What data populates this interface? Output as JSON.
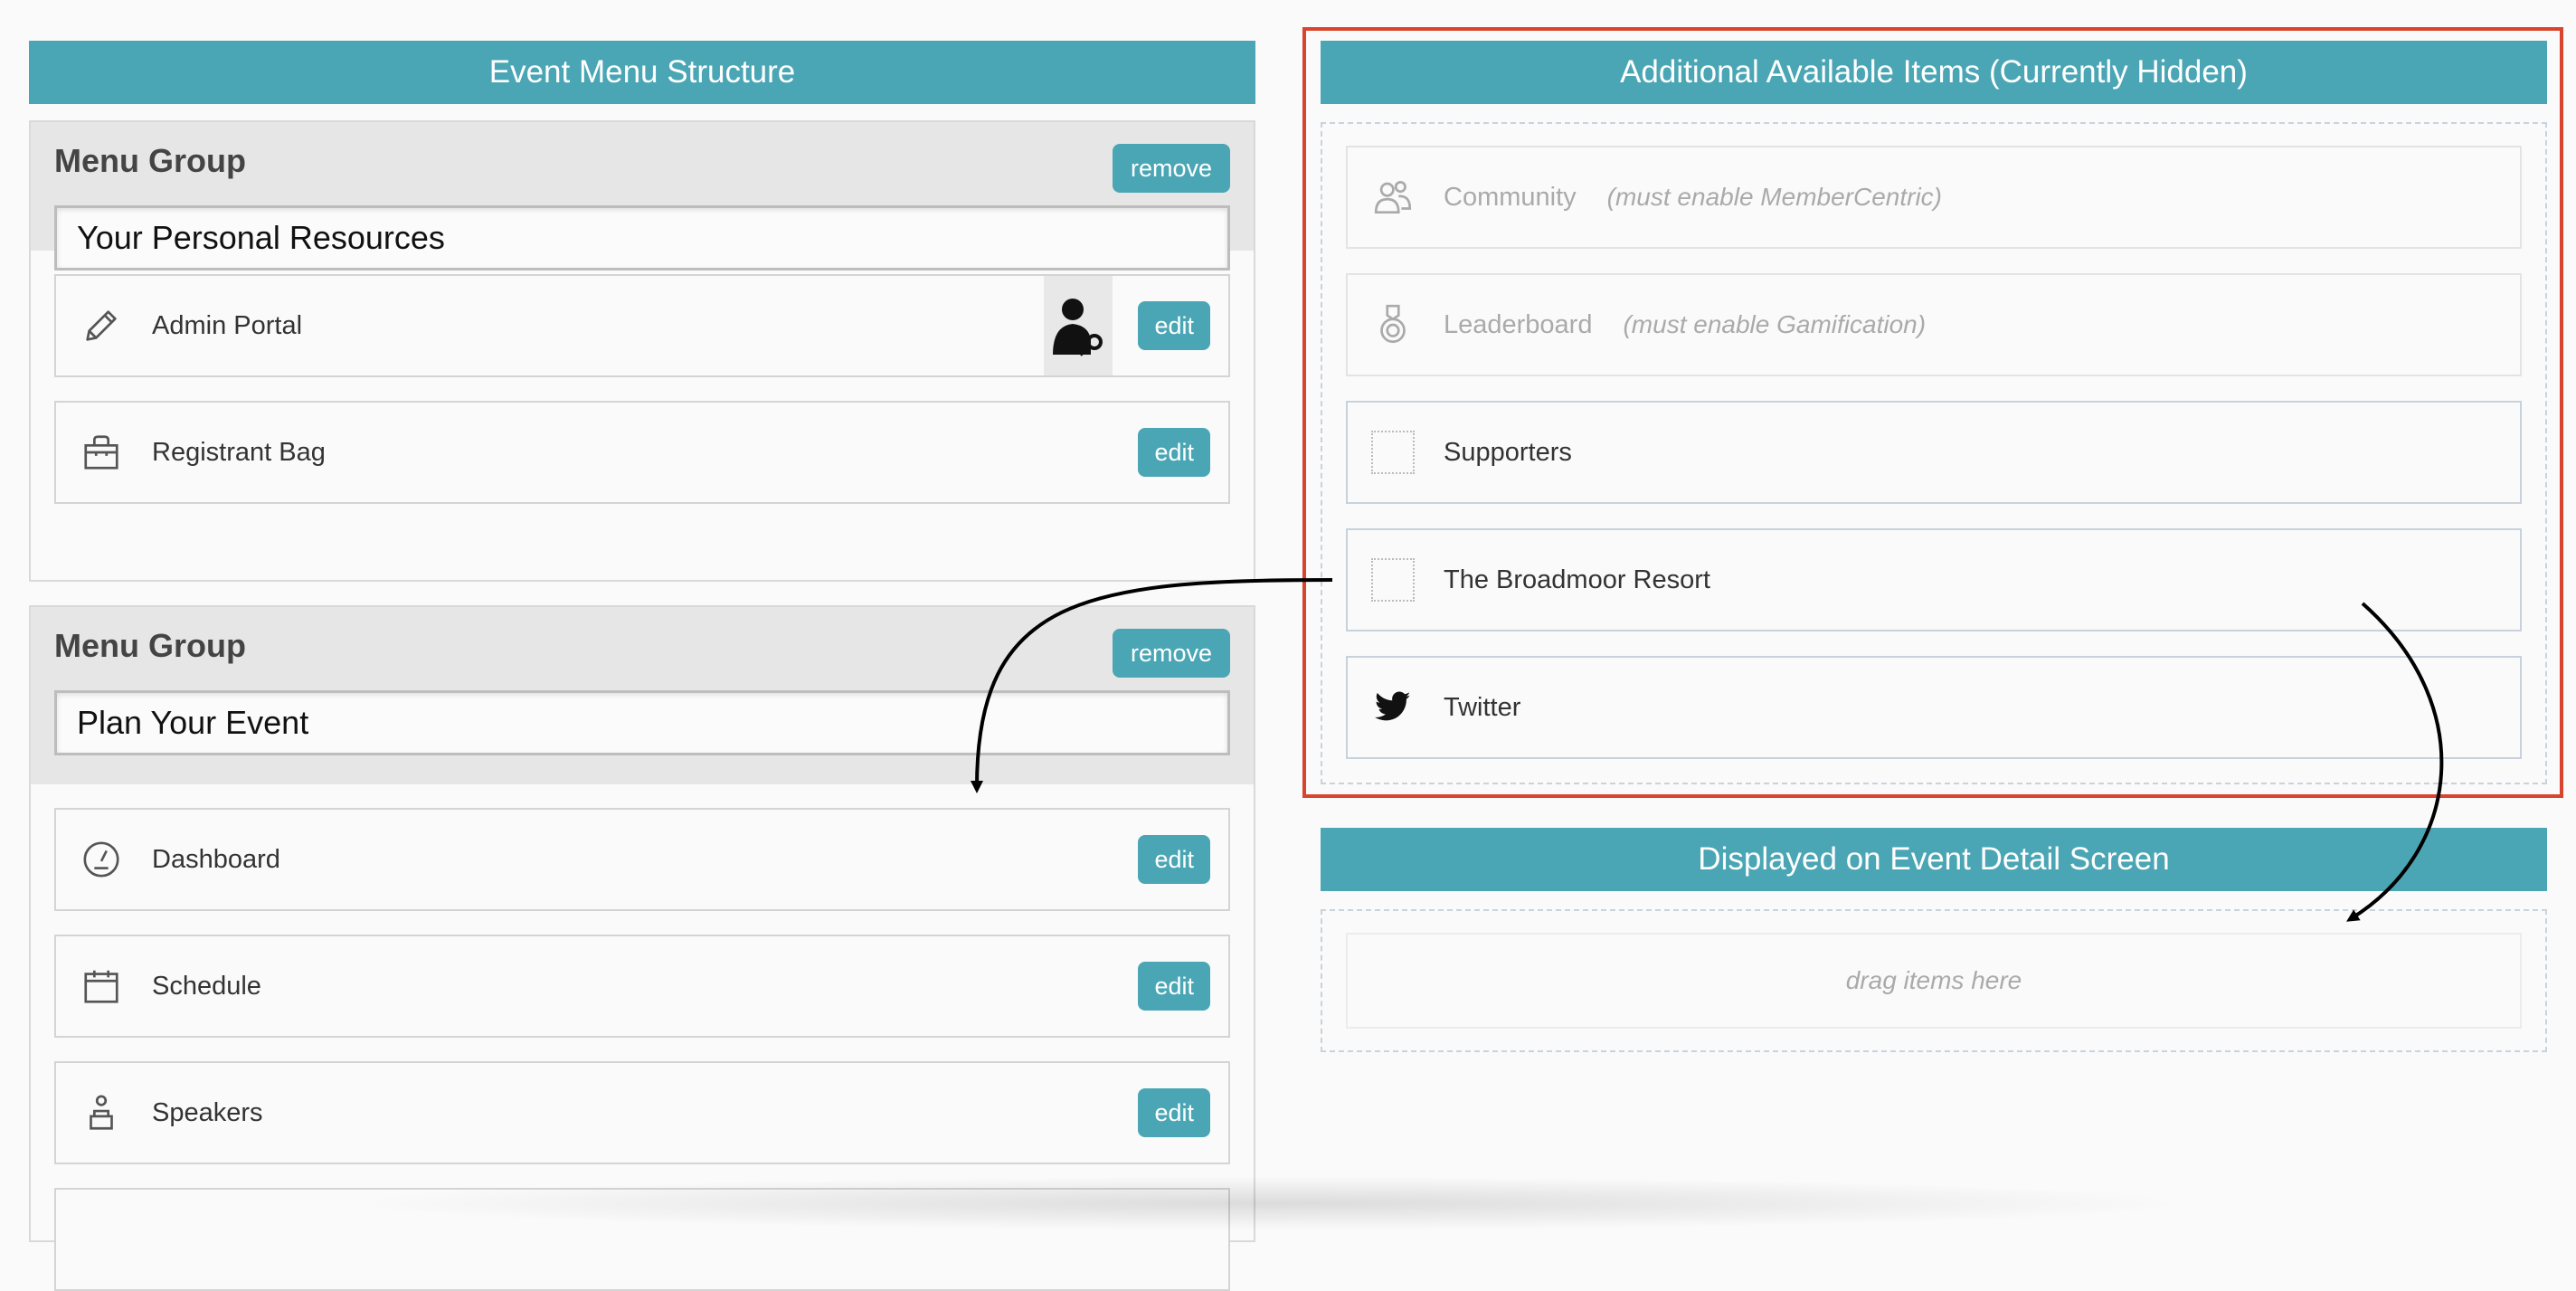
{
  "left": {
    "header": "Event Menu Structure",
    "groups": [
      {
        "title": "Menu Group",
        "remove_label": "remove",
        "name_value": "Your Personal Resources",
        "items": [
          {
            "label": "Admin Portal",
            "icon": "pencil-icon",
            "edit_label": "edit"
          },
          {
            "label": "Registrant Bag",
            "icon": "bag-icon",
            "edit_label": "edit"
          }
        ]
      },
      {
        "title": "Menu Group",
        "remove_label": "remove",
        "name_value": "Plan Your Event",
        "items": [
          {
            "label": "Dashboard",
            "icon": "gauge-icon",
            "edit_label": "edit"
          },
          {
            "label": "Schedule",
            "icon": "calendar-icon",
            "edit_label": "edit"
          },
          {
            "label": "Speakers",
            "icon": "speaker-icon",
            "edit_label": "edit"
          }
        ]
      }
    ]
  },
  "right": {
    "available_header": "Additional Available Items (Currently Hidden)",
    "available_items": [
      {
        "label": "Community",
        "note": "(must enable MemberCentric)",
        "icon": "people-icon"
      },
      {
        "label": "Leaderboard",
        "note": "(must enable Gamification)",
        "icon": "medal-icon"
      },
      {
        "label": "Supporters",
        "icon": "placeholder-icon"
      },
      {
        "label": "The Broadmoor Resort",
        "icon": "placeholder-icon"
      },
      {
        "label": "Twitter",
        "icon": "twitter-icon"
      }
    ],
    "detail_header": "Displayed on Event Detail Screen",
    "drop_hint": "drag items here"
  },
  "colors": {
    "accent": "#4aa6b4",
    "highlight": "#d9442e"
  }
}
